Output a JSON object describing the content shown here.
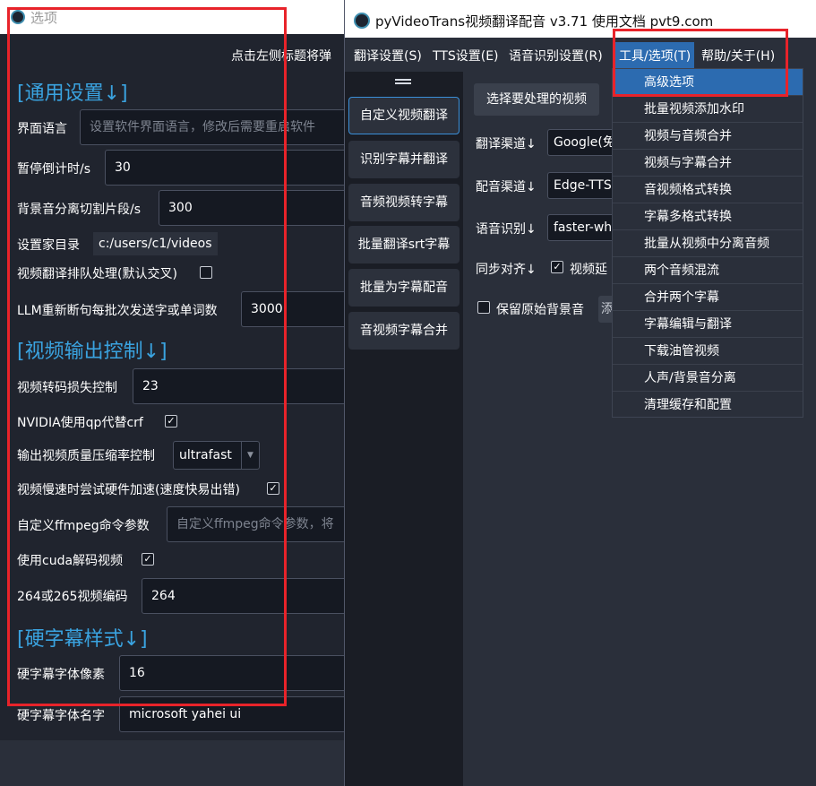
{
  "options_window": {
    "title": "选项",
    "hint": "点击左侧标题将弹",
    "sections": {
      "general": "[通用设置↓]",
      "video_output": "[视频输出控制↓]",
      "hard_subtitle": "[硬字幕样式↓]"
    },
    "rows": {
      "ui_language_label": "界面语言",
      "ui_language_placeholder": "设置软件界面语言，修改后需要重启软件",
      "countdown_label": "暂停倒计时/s",
      "countdown_value": "30",
      "bg_segment_label": "背景音分离切割片段/s",
      "bg_segment_value": "300",
      "home_dir_label": "设置家目录",
      "home_dir_value": "c:/users/c1/videos",
      "queue_label": "视频翻译排队处理(默认交叉)",
      "queue_checked": false,
      "llm_batch_label": "LLM重新断句每批次发送字或单词数",
      "llm_batch_value": "3000",
      "crf_label": "视频转码损失控制",
      "crf_value": "23",
      "nvidia_qp_label": "NVIDIA使用qp代替crf",
      "nvidia_qp_checked": true,
      "preset_label": "输出视频质量压缩率控制",
      "preset_value": "ultrafast",
      "hw_accel_label": "视频慢速时尝试硬件加速(速度快易出错)",
      "hw_accel_checked": true,
      "ffmpeg_label": "自定义ffmpeg命令参数",
      "ffmpeg_placeholder": "自定义ffmpeg命令参数，将",
      "cuda_label": "使用cuda解码视频",
      "cuda_checked": true,
      "codec_label": "264或265视频编码",
      "codec_value": "264",
      "font_size_label": "硬字幕字体像素",
      "font_size_value": "16",
      "font_name_label": "硬字幕字体名字",
      "font_name_value": "microsoft yahei ui"
    }
  },
  "main_window": {
    "title": "pyVideoTrans视频翻译配音 v3.71  使用文档  pvt9.com",
    "menu": [
      "翻译设置(S)",
      "TTS设置(E)",
      "语音识别设置(R)",
      "工具/选项(T)",
      "帮助/关于(H)"
    ],
    "sidebar": [
      "自定义视频翻译",
      "识别字幕并翻译",
      "音频视频转字幕",
      "批量翻译srt字幕",
      "批量为字幕配音",
      "音视频字幕合并"
    ],
    "select_video_button": "选择要处理的视频",
    "translate_channel_label": "翻译渠道↓",
    "translate_channel_value": "Google(免",
    "dubbing_channel_label": "配音渠道↓",
    "dubbing_channel_value": "Edge-TTS",
    "asr_label": "语音识别↓",
    "asr_value": "faster-wh",
    "sync_label": "同步对齐↓",
    "video_delay_label": "视频延",
    "keep_bg_label": "保留原始背景音",
    "keep_bg_extra": "添"
  },
  "dropdown": {
    "items": [
      "高级选项",
      "批量视频添加水印",
      "视频与音频合并",
      "视频与字幕合并",
      "音视频格式转换",
      "字幕多格式转换",
      "批量从视频中分离音频",
      "两个音频混流",
      "合并两个字幕",
      "字幕编辑与翻译",
      "下载油管视频",
      "人声/背景音分离",
      "清理缓存和配置"
    ],
    "highlighted_index": 0
  },
  "colors": {
    "accent_blue": "#3aa3e0",
    "highlight": "#2c6bb0",
    "annotation_red": "#e8232a"
  }
}
